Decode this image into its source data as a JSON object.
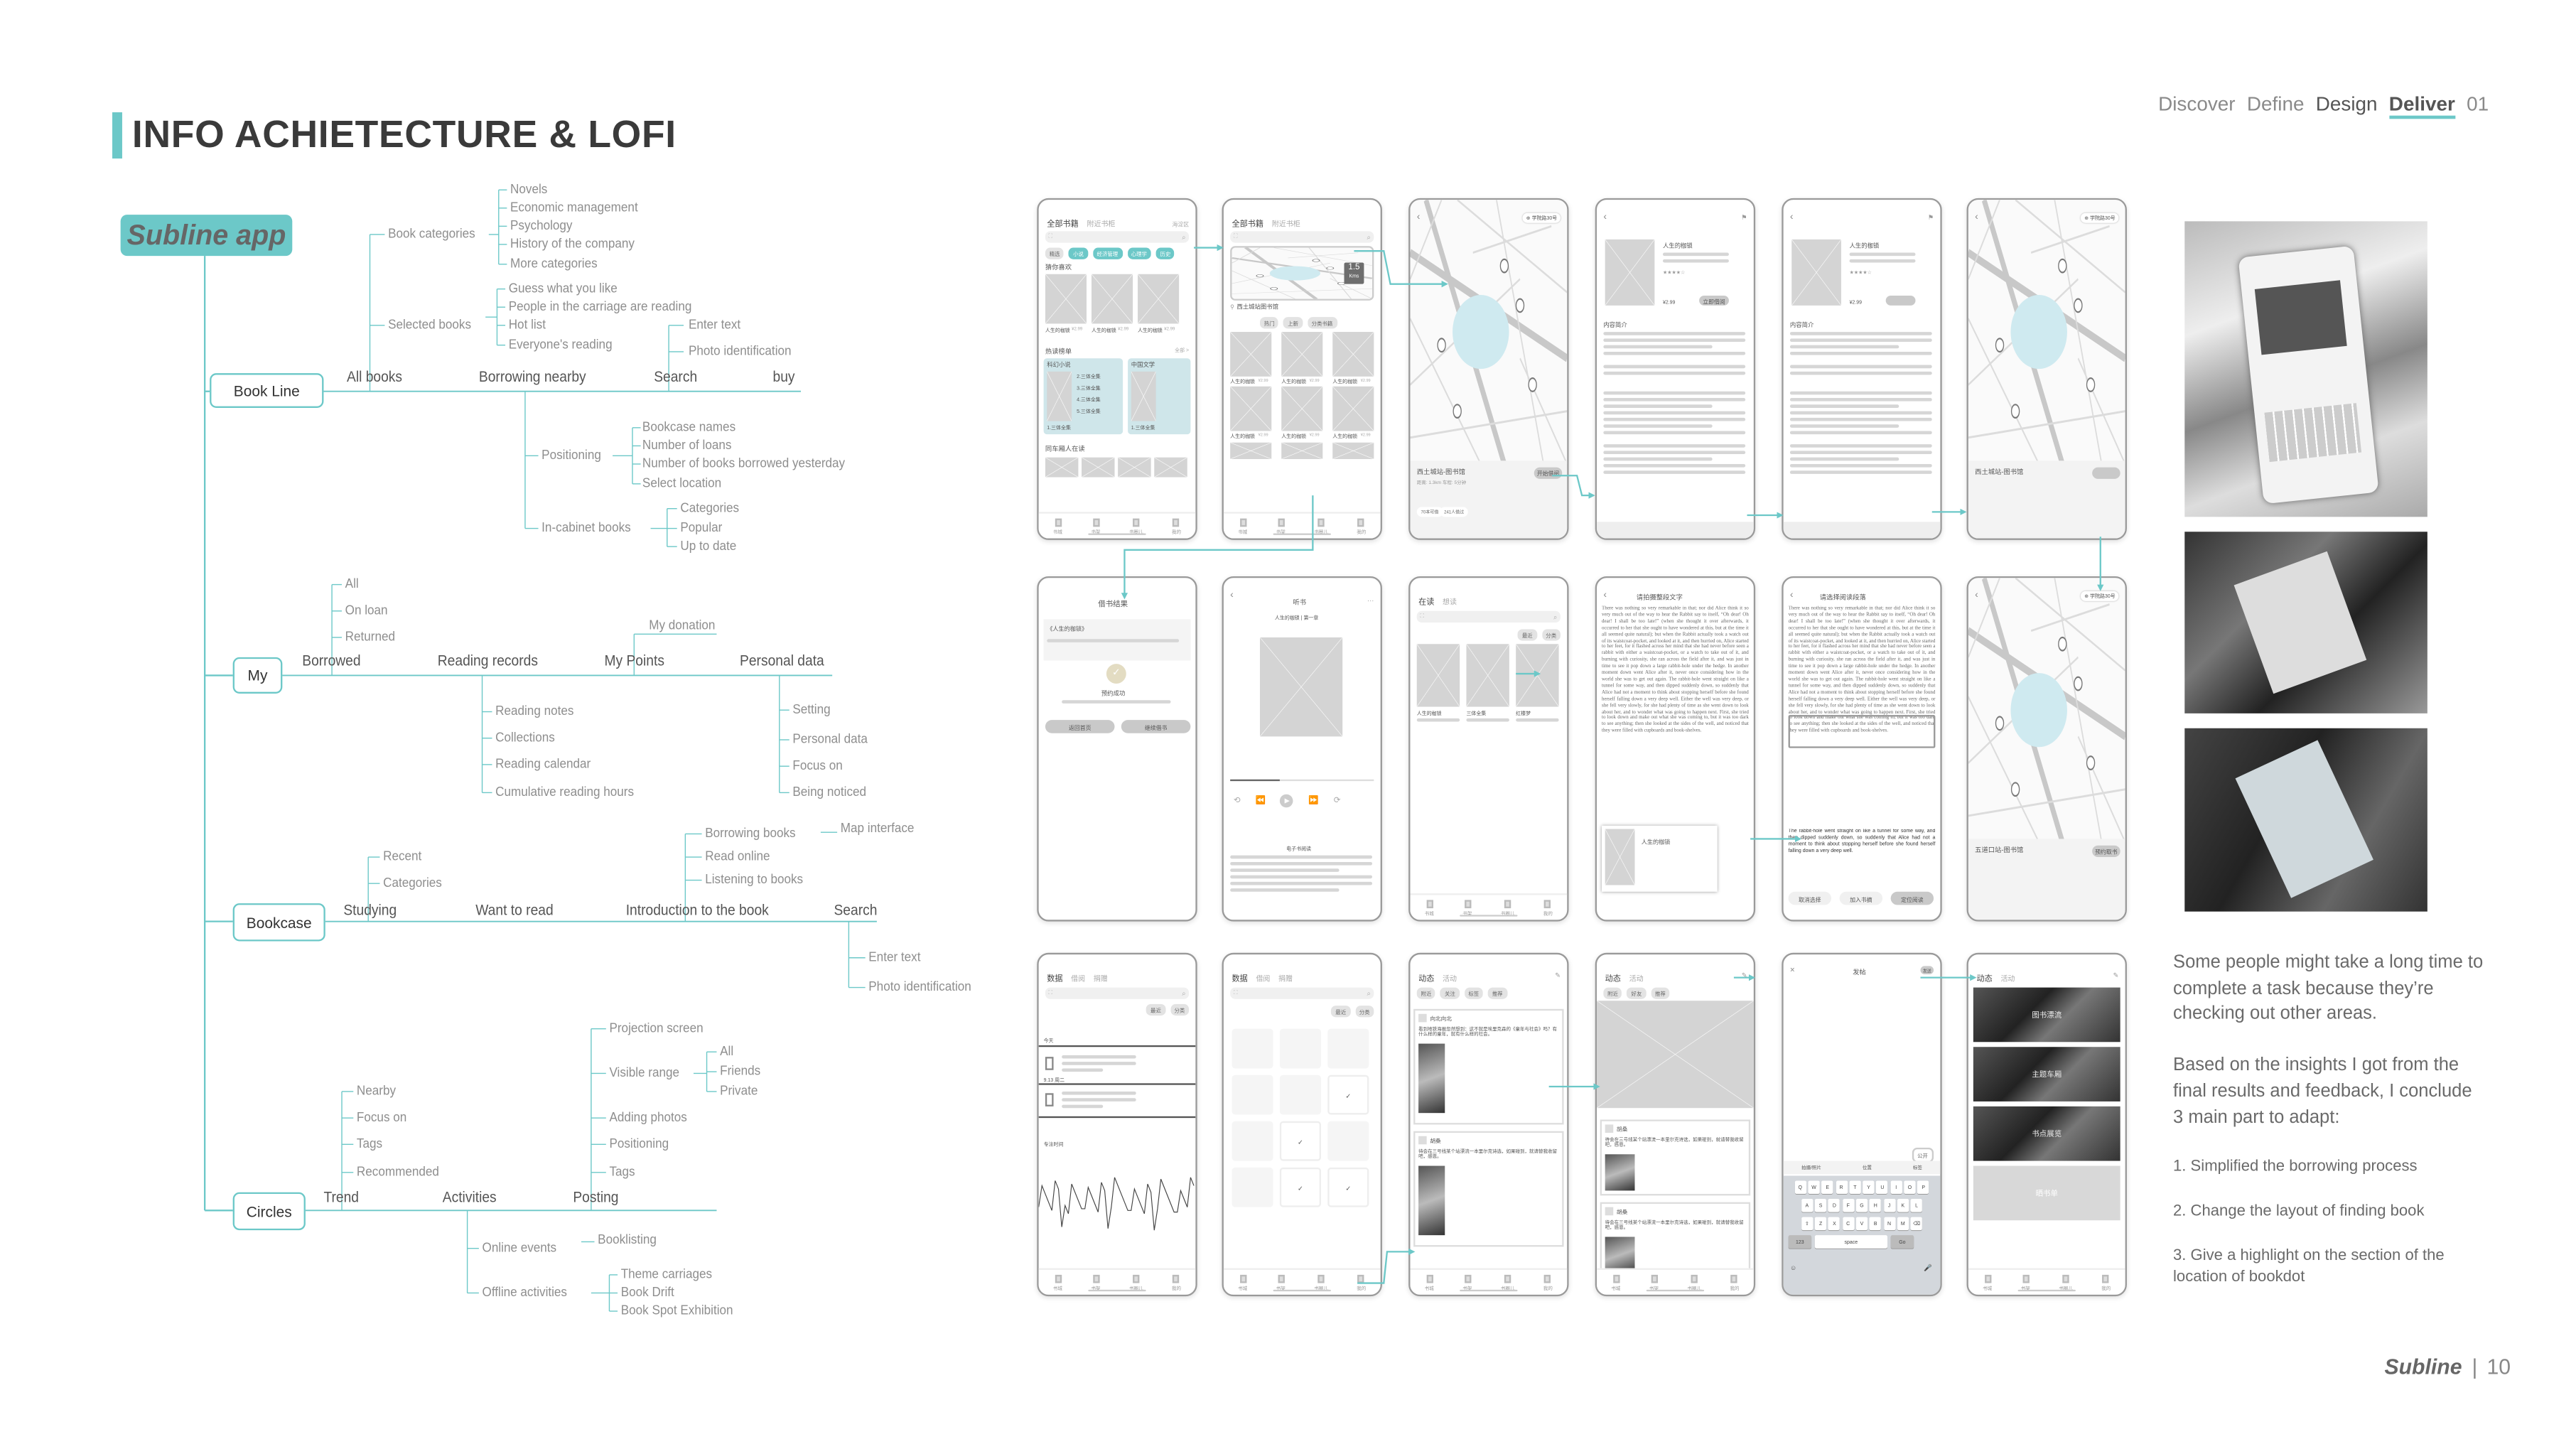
{
  "header": {
    "title": "INFO ACHIETECTURE & LOFI",
    "nav": [
      "Discover",
      "Define",
      "Design",
      "Deliver",
      "01"
    ],
    "active_nav": "Deliver"
  },
  "colors": {
    "accent": "#6cc8c8",
    "text": "#8a8a8a",
    "dark_text": "#555555",
    "map_highlight": "#cfeaf0"
  },
  "tree": {
    "root": "Subline app",
    "book_line": {
      "label": "Book Line",
      "children": [
        "All books",
        "Borrowing nearby",
        "Search",
        "buy"
      ],
      "book_categories": "Book categories",
      "categories_items": [
        "Novels",
        "Economic management",
        "Psychology",
        "History of the company",
        "More categories"
      ],
      "selected_books": "Selected books",
      "selected_items": [
        "Guess what you like",
        "People in the carriage are reading",
        "Hot list",
        "Everyone's reading"
      ],
      "search_items": [
        "Enter text",
        "Photo identification"
      ],
      "positioning": "Positioning",
      "positioning_items": [
        "Bookcase names",
        "Number of loans",
        "Number of books borrowed yesterday",
        "Select location"
      ],
      "in_cabinet": "In-cabinet books",
      "in_cabinet_items": [
        "Categories",
        "Popular",
        "Up to date"
      ]
    },
    "my": {
      "label": "My",
      "children": [
        "Borrowed",
        "Reading records",
        "My Points",
        "Personal data"
      ],
      "borrowed_items": [
        "All",
        "On loan",
        "Returned"
      ],
      "my_donation": "My donation",
      "reading_items": [
        "Reading notes",
        "Collections",
        "Reading calendar",
        "Cumulative reading hours"
      ],
      "personal_items": [
        "Setting",
        "Personal data",
        "Focus on",
        "Being noticed"
      ]
    },
    "bookcase": {
      "label": "Bookcase",
      "children": [
        "Studying",
        "Want to read",
        "Introduction to the book",
        "Search"
      ],
      "studying_items": [
        "Recent",
        "Categories"
      ],
      "intro_items": [
        "Borrowing books",
        "Read online",
        "Listening to books"
      ],
      "map_interface": "Map interface",
      "search_items": [
        "Enter text",
        "Photo identification"
      ]
    },
    "circles": {
      "label": "Circles",
      "children": [
        "Trend",
        "Activities",
        "Posting"
      ],
      "trend_items": [
        "Nearby",
        "Focus on",
        "Tags",
        "Recommended"
      ],
      "posting_items": [
        "Projection screen",
        "Visible range",
        "Adding photos",
        "Positioning",
        "Tags"
      ],
      "visible_range_items": [
        "All",
        "Friends",
        "Private"
      ],
      "activities_items": [
        "Online events",
        "Offline activities"
      ],
      "booklisting": "Booklisting",
      "offline_items": [
        "Theme carriages",
        "Book Drift",
        "Book Spot Exhibition"
      ]
    }
  },
  "nav_labels": [
    "书城",
    "书架",
    "书圈儿",
    "我的"
  ],
  "alice_text": "There was nothing so very remarkable in that; nor did Alice think it so very much out of the way to hear the Rabbit say to itself, “Oh dear! Oh dear! I shall be too late!” (when she thought it over afterwards, it occurred to her that she ought to have wondered at this, but at the time it all seemed quite natural); but when the Rabbit actually took a watch out of its waistcoat-pocket, and looked at it, and then hurried on, Alice started to her feet, for it flashed across her mind that she had never before seen a rabbit with either a waistcoat-pocket, or a watch to take out of it, and burning with curiosity, she ran across the field after it, and was just in time to see it pop down a large rabbit-hole under the hedge. In another moment down went Alice after it, never once considering how in the world she was to get out again. The rabbit-hole went straight on like a tunnel for some way, and then dipped suddenly down, so suddenly that Alice had not a moment to think about stopping herself before she found herself falling down a very deep well. Either the well was very deep, or she fell very slowly, for she had plenty of time as she went down to look about her, and to wonder what was going to happen next. First, she tried to look down and make out what she was coming to, but it was too dark to see anything; then she looked at the sides of the well, and noticed that they were filled with cupboards and book-shelves.",
  "phones": [
    {
      "type": "home",
      "tabs": [
        "全部书籍",
        "附近书柜"
      ],
      "region": "海淀区",
      "chips": [
        "精选",
        "小说",
        "经济管理",
        "心理学",
        "历史"
      ],
      "sections": [
        "猜你喜欢",
        "热读榜单",
        "同车厢人在读"
      ],
      "more": "全部 >",
      "book": "人生的枷锁",
      "price": "¥2.99",
      "lists": [
        "科幻小说",
        "中国文学"
      ],
      "list_items": [
        "1.三体全集",
        "2.三体全集",
        "3.三体全集",
        "4.三体全集",
        "5.三体全集"
      ]
    },
    {
      "type": "nearby",
      "tabs": [
        "全部书籍",
        "附近书柜"
      ],
      "distance": "1.5",
      "unit": "Kms",
      "library": "西土城站图书馆",
      "chips": [
        "热门",
        "上新",
        "分类书籍"
      ],
      "book": "人生的枷锁",
      "price": "¥2.99"
    },
    {
      "type": "map",
      "location": "学院路30号",
      "library": "西土城站-图书馆",
      "info": "距离: 1.3km   车程: 5分钟",
      "tags": [
        "70本可借",
        "241人借过"
      ],
      "button": "开始借阅"
    },
    {
      "type": "detail",
      "title": "人生的枷锁",
      "price": "¥2.99",
      "button": "立即借阅",
      "heading": "内容简介"
    },
    {
      "type": "detail",
      "title": "人生的枷锁",
      "price": "¥2.99",
      "heading": "内容简介"
    },
    {
      "type": "map",
      "location": "学院路30号",
      "library": "西土城站-图书馆"
    },
    {
      "type": "result",
      "title": "借书结果",
      "book": "《人生的枷锁》",
      "status": "预约成功",
      "buttons": [
        "返回首页",
        "继续借书"
      ]
    },
    {
      "type": "audio",
      "title": "听书",
      "chapter": "人生的枷锁 | 第一章",
      "footer": "电子书阅读"
    },
    {
      "type": "shelf",
      "tabs": [
        "在读",
        "想读"
      ],
      "chips": [
        "最近",
        "分类"
      ],
      "books": [
        "人生的枷锁",
        "三体全集",
        "红楼梦"
      ]
    },
    {
      "type": "reader",
      "title": "请拍摄整段文字",
      "book": "人生的枷锁"
    },
    {
      "type": "reader_select",
      "title": "请选择阅读段落",
      "excerpt": "The rabbit-hole went straight on like a tunnel for some way, and then dipped suddenly down, so suddenly that Alice had not a moment to think about stopping herself before she found herself falling down a very deep well.",
      "buttons": [
        "取消选择",
        "加入书摘",
        "定位阅读"
      ]
    },
    {
      "type": "map",
      "location": "学院路30号",
      "library": "五道口站-图书馆",
      "button": "预约取书"
    },
    {
      "type": "data",
      "tabs": [
        "数据",
        "借阅",
        "捐赠"
      ],
      "chips": [
        "最近",
        "分类"
      ],
      "rows": [
        "今天",
        "9.13 周二"
      ],
      "chart_label": "专注时间"
    },
    {
      "type": "calendar",
      "tabs": [
        "数据",
        "借阅",
        "捐赠"
      ],
      "chips": [
        "最近",
        "分类"
      ]
    },
    {
      "type": "feed",
      "tabs": [
        "动态",
        "活动"
      ],
      "chips": [
        "附近",
        "关注",
        "标签",
        "推荐"
      ],
      "posts": [
        {
          "name": "向北向北",
          "text": "看到地铁海报忽然想到：这不就是埃里克森的《童年与社会》吗？有什么样的童年，就有什么样的社会。"
        },
        {
          "name": "胡桑",
          "text": "待会在三号线某个站漂流一本里尔克诗选，如果碰到，就请替我收留吧，感恩。"
        }
      ]
    },
    {
      "type": "feed",
      "tabs": [
        "动态",
        "活动"
      ],
      "chips": [
        "附近",
        "好友",
        "推荐"
      ],
      "posts": [
        {
          "name": "胡桑",
          "text": "待会在三号线某个站漂流一本里尔克诗选，如果碰到，就请替我收留吧，感恩。"
        },
        {
          "name": "胡桑",
          "text": "待会在三号线某个站漂流一本里尔克诗选，如果碰到，就请替我收留吧，感恩。"
        }
      ]
    },
    {
      "type": "keyboard",
      "title": "发帖",
      "button": "发送",
      "visibility": "公开",
      "options": [
        "拍摄/照片",
        "位置",
        "标签"
      ],
      "keys": [
        [
          "Q",
          "W",
          "E",
          "R",
          "T",
          "Y",
          "U",
          "I",
          "O",
          "P"
        ],
        [
          "A",
          "S",
          "D",
          "F",
          "G",
          "H",
          "J",
          "K",
          "L"
        ],
        [
          "Z",
          "X",
          "C",
          "V",
          "B",
          "N",
          "M"
        ]
      ],
      "num": "123",
      "space": "space",
      "go": "Go"
    },
    {
      "type": "events",
      "tabs": [
        "动态",
        "活动"
      ],
      "cards": [
        "图书漂流",
        "主题车厢",
        "书点展览",
        "晒书单"
      ]
    }
  ],
  "notes": {
    "paragraphs": [
      "Some people might take a long time to complete a task because they’re checking out other areas.",
      "Based on the insights I got from the final results and feedback, I conclude 3 main part to adapt:"
    ],
    "items": [
      "1. Simplified the borrowing process",
      "2. Change the layout of finding book",
      "3. Give a highlight on the section of the location of bookdot"
    ]
  },
  "footer": {
    "brand": "Subline",
    "page": "10"
  }
}
